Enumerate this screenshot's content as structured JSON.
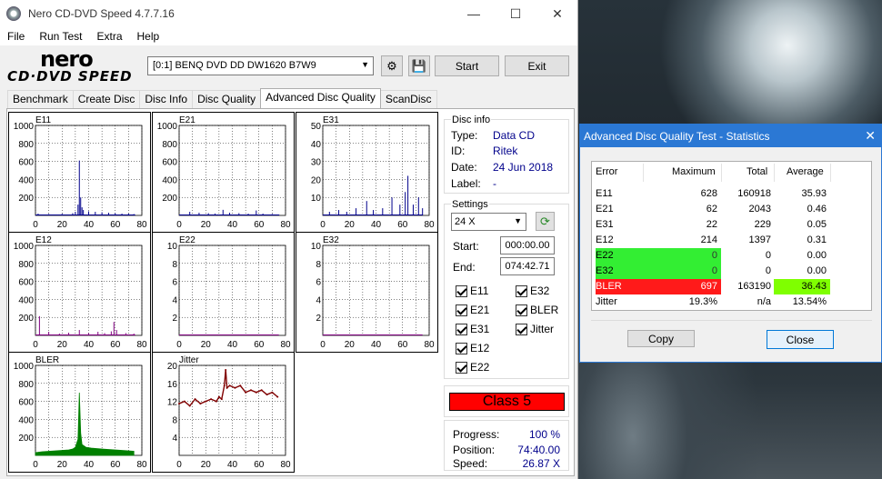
{
  "main_window": {
    "title": "Nero CD-DVD Speed 4.7.7.16",
    "menu": [
      "File",
      "Run Test",
      "Extra",
      "Help"
    ],
    "logo_top": "nero",
    "logo_bottom": "CD·DVD SPEED",
    "drive": "[0:1]   BENQ DVD DD DW1620 B7W9",
    "buttons": {
      "start": "Start",
      "exit": "Exit"
    },
    "tabs": [
      "Benchmark",
      "Create Disc",
      "Disc Info",
      "Disc Quality",
      "Advanced Disc Quality",
      "ScanDisc"
    ],
    "active_tab": "Advanced Disc Quality"
  },
  "disc_info": {
    "title": "Disc info",
    "fields": [
      {
        "key": "Type:",
        "value": "Data CD"
      },
      {
        "key": "ID:",
        "value": "Ritek"
      },
      {
        "key": "Date:",
        "value": "24 Jun 2018"
      },
      {
        "key": "Label:",
        "value": "-"
      }
    ]
  },
  "settings": {
    "title": "Settings",
    "speed": "24 X",
    "start_label": "Start:",
    "start_value": "000:00.00",
    "end_label": "End:",
    "end_value": "074:42.71",
    "checks_left": [
      "E11",
      "E21",
      "E31",
      "E12",
      "E22"
    ],
    "checks_right": [
      "E32",
      "BLER",
      "Jitter"
    ]
  },
  "class_label": "Class 5",
  "progress": {
    "progress_label": "Progress:",
    "progress_value": "100 %",
    "position_label": "Position:",
    "position_value": "74:40.00",
    "speed_label": "Speed:",
    "speed_value": "26.87 X"
  },
  "charts": [
    {
      "name": "E11",
      "ylabels": [
        "1000",
        "800",
        "600",
        "400",
        "200"
      ],
      "ymax": 1000,
      "color": "#00008b",
      "type": "spikes",
      "data": [
        [
          2,
          20
        ],
        [
          10,
          15
        ],
        [
          20,
          18
        ],
        [
          28,
          25
        ],
        [
          30,
          40
        ],
        [
          32,
          120
        ],
        [
          33,
          610
        ],
        [
          34,
          200
        ],
        [
          35,
          90
        ],
        [
          36,
          60
        ],
        [
          40,
          45
        ],
        [
          45,
          40
        ],
        [
          50,
          35
        ],
        [
          55,
          30
        ],
        [
          60,
          25
        ],
        [
          65,
          20
        ],
        [
          70,
          20
        ],
        [
          74,
          15
        ]
      ]
    },
    {
      "name": "E21",
      "ylabels": [
        "1000",
        "800",
        "600",
        "400",
        "200"
      ],
      "ymax": 1000,
      "color": "#00008b",
      "type": "spikes",
      "data": [
        [
          3,
          10
        ],
        [
          8,
          40
        ],
        [
          15,
          30
        ],
        [
          22,
          25
        ],
        [
          27,
          20
        ],
        [
          33,
          62
        ],
        [
          38,
          30
        ],
        [
          45,
          25
        ],
        [
          52,
          20
        ],
        [
          58,
          55
        ],
        [
          63,
          20
        ],
        [
          70,
          15
        ],
        [
          75,
          10
        ]
      ]
    },
    {
      "name": "E31",
      "ylabels": [
        "50",
        "40",
        "30",
        "20",
        "10"
      ],
      "ymax": 50,
      "color": "#00008b",
      "type": "spikes",
      "data": [
        [
          5,
          2
        ],
        [
          12,
          3
        ],
        [
          18,
          2
        ],
        [
          25,
          4
        ],
        [
          33,
          8
        ],
        [
          38,
          3
        ],
        [
          45,
          4
        ],
        [
          52,
          10
        ],
        [
          58,
          6
        ],
        [
          62,
          13
        ],
        [
          64,
          22
        ],
        [
          68,
          6
        ],
        [
          72,
          10
        ],
        [
          75,
          4
        ]
      ]
    },
    {
      "name": "E12",
      "ylabels": [
        "1000",
        "800",
        "600",
        "400",
        "200"
      ],
      "ymax": 1000,
      "color": "#800080",
      "type": "spikes",
      "data": [
        [
          3,
          214
        ],
        [
          10,
          40
        ],
        [
          18,
          20
        ],
        [
          25,
          30
        ],
        [
          33,
          60
        ],
        [
          40,
          25
        ],
        [
          47,
          40
        ],
        [
          52,
          25
        ],
        [
          57,
          45
        ],
        [
          59,
          150
        ],
        [
          61,
          60
        ],
        [
          68,
          25
        ],
        [
          74,
          20
        ]
      ]
    },
    {
      "name": "E22",
      "ylabels": [
        "10",
        "8",
        "6",
        "4",
        "2"
      ],
      "ymax": 10,
      "color": "#800080",
      "type": "spikes",
      "data": []
    },
    {
      "name": "E32",
      "ylabels": [
        "10",
        "8",
        "6",
        "4",
        "2"
      ],
      "ymax": 10,
      "color": "#800080",
      "type": "spikes",
      "data": []
    },
    {
      "name": "BLER",
      "ylabels": [
        "1000",
        "800",
        "600",
        "400",
        "200"
      ],
      "ymax": 1000,
      "color": "#008000",
      "type": "area",
      "data": [
        [
          0,
          30
        ],
        [
          5,
          40
        ],
        [
          10,
          45
        ],
        [
          15,
          50
        ],
        [
          20,
          55
        ],
        [
          25,
          60
        ],
        [
          28,
          70
        ],
        [
          30,
          90
        ],
        [
          32,
          180
        ],
        [
          33,
          697
        ],
        [
          34,
          250
        ],
        [
          35,
          120
        ],
        [
          38,
          90
        ],
        [
          42,
          80
        ],
        [
          46,
          75
        ],
        [
          50,
          70
        ],
        [
          55,
          65
        ],
        [
          60,
          60
        ],
        [
          65,
          55
        ],
        [
          70,
          50
        ],
        [
          74,
          45
        ]
      ]
    },
    {
      "name": "Jitter",
      "ylabels": [
        "20",
        "16",
        "12",
        "8",
        "4"
      ],
      "ymax": 20,
      "color": "#800000",
      "type": "line",
      "data": [
        [
          0,
          11.5
        ],
        [
          4,
          12
        ],
        [
          8,
          11
        ],
        [
          12,
          12.5
        ],
        [
          16,
          11.5
        ],
        [
          20,
          12
        ],
        [
          24,
          12.5
        ],
        [
          28,
          12
        ],
        [
          30,
          13
        ],
        [
          32,
          12.5
        ],
        [
          34,
          15.5
        ],
        [
          35,
          19
        ],
        [
          36,
          15
        ],
        [
          38,
          15.5
        ],
        [
          42,
          15
        ],
        [
          46,
          15.5
        ],
        [
          50,
          14
        ],
        [
          54,
          14.5
        ],
        [
          58,
          14
        ],
        [
          62,
          14.5
        ],
        [
          66,
          13.5
        ],
        [
          70,
          14
        ],
        [
          74,
          13
        ]
      ]
    }
  ],
  "x_ticks": [
    "0",
    "20",
    "40",
    "60",
    "80"
  ],
  "stats": {
    "title": "Advanced Disc Quality Test - Statistics",
    "headers": [
      "Error",
      "Maximum",
      "Total",
      "Average"
    ],
    "rows": [
      {
        "error": "E11",
        "maximum": "628",
        "total": "160918",
        "average": "35.93"
      },
      {
        "error": "E21",
        "maximum": "62",
        "total": "2043",
        "average": "0.46"
      },
      {
        "error": "E31",
        "maximum": "22",
        "total": "229",
        "average": "0.05"
      },
      {
        "error": "E12",
        "maximum": "214",
        "total": "1397",
        "average": "0.31"
      },
      {
        "error": "E22",
        "maximum": "0",
        "total": "0",
        "average": "0.00"
      },
      {
        "error": "E32",
        "maximum": "0",
        "total": "0",
        "average": "0.00"
      },
      {
        "error": "BLER",
        "maximum": "697",
        "total": "163190",
        "average": "36.43"
      },
      {
        "error": "Jitter",
        "maximum": "19.3%",
        "total": "n/a",
        "average": "13.54%"
      }
    ],
    "copy": "Copy",
    "close": "Close",
    "colors": {
      "green": "#33ee33",
      "red": "#ff1a1a",
      "lime": "#7fff00"
    }
  }
}
